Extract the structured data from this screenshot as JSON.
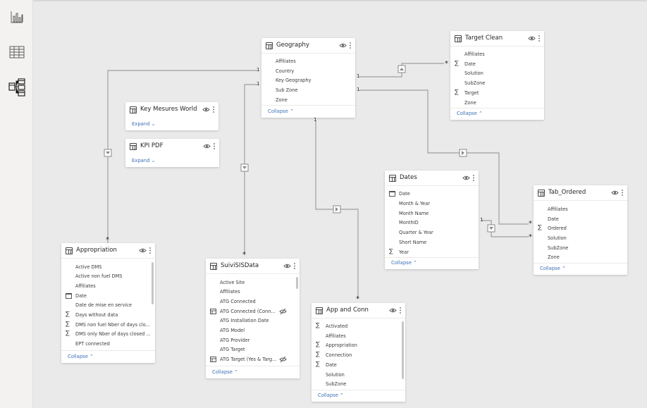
{
  "colors": {
    "rail_bg": "#f3f2f1",
    "canvas_bg": "#ebeaea",
    "link": "#3a6eb5",
    "line": "#a19f9d"
  },
  "rail": {
    "items": [
      {
        "name": "report-view",
        "icon": "bar-chart-icon"
      },
      {
        "name": "data-view",
        "icon": "table-grid-icon"
      },
      {
        "name": "model-view",
        "icon": "model-diagram-icon"
      }
    ]
  },
  "tables": {
    "geography": {
      "title": "Geography",
      "collapse": "Collapse",
      "fields": [
        "Affiliates",
        "Country",
        "Key Geography",
        "Sub Zone",
        "Zone"
      ]
    },
    "target_clean": {
      "title": "Target Clean",
      "collapse": "Collapse",
      "fields": [
        "Affiliates",
        "Date",
        "Solution",
        "SubZone",
        "Target",
        "Zone"
      ]
    },
    "key_mesures": {
      "title": "Key Mesures World",
      "expand": "Expand"
    },
    "kpi_pdf": {
      "title": "KPI PDF",
      "expand": "Expand"
    },
    "dates": {
      "title": "Dates",
      "collapse": "Collapse",
      "fields": [
        "Date",
        "Month & Year",
        "Month Name",
        "MonthID",
        "Quarter & Year",
        "Short Name",
        "Year"
      ]
    },
    "tab_ordered": {
      "title": "Tab_Ordered",
      "collapse": "Collapse",
      "fields": [
        "Affiliates",
        "Date",
        "Ordered",
        "Solution",
        "SubZone",
        "Zone"
      ]
    },
    "appropriation": {
      "title": "Appropriation",
      "collapse": "Collapse",
      "fields": [
        "Active DMS",
        "Active non fuel DMS",
        "Affiliates",
        "Date",
        "Date de mise en service",
        "Days without data",
        "DMS non fuel Nber of days clo...",
        "DMS only Nber of days closed ...",
        "EPT connected"
      ]
    },
    "suivisis": {
      "title": "SuiviSISData",
      "collapse": "Collapse",
      "fields": [
        "Active Site",
        "Affiliates",
        "ATG Connected",
        "ATG Connected (Conn...",
        "ATG Installation Date",
        "ATG Model",
        "ATG Provider",
        "ATG Target",
        "ATG Target (Yes & Targ..."
      ]
    },
    "app_conn": {
      "title": "App and Conn",
      "collapse": "Collapse",
      "fields": [
        "Activated",
        "Affiliates",
        "Appropriation",
        "Connection",
        "Date",
        "Solution",
        "SubZone"
      ]
    }
  },
  "relationships": {
    "one": "1",
    "many": "*"
  }
}
